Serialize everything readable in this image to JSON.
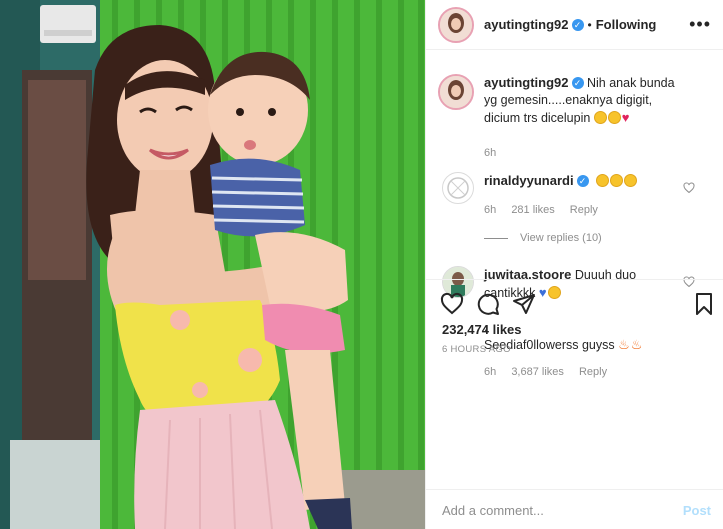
{
  "header": {
    "username": "ayutingting92",
    "separator": "•",
    "follow_status": "Following"
  },
  "caption": {
    "username": "ayutingting92",
    "text": "Nih anak bunda yg gemesin.....enaknya digigit, dicium trs dicelupin",
    "emojis": [
      "smiling-face-icon",
      "kissing-face-icon",
      "red-heart-icon"
    ],
    "time": "6h"
  },
  "comments": [
    {
      "username": "rinaldyyunardi",
      "verified": true,
      "text": "",
      "emojis": [
        "smiling-face-icon",
        "smiling-face-icon",
        "smiling-face-icon"
      ],
      "time": "6h",
      "likes": "281 likes",
      "reply": "Reply",
      "view_replies": "View replies (10)"
    },
    {
      "username": "juwitaa.stoore",
      "verified": false,
      "text": "Duuuh duo cantikkkk",
      "lines": [
        ".",
        ".",
        "Seediaf0llowerss guyss"
      ],
      "emojis": [
        "blue-heart-icon",
        "heart-eyes-face-icon"
      ],
      "trailing_emojis": [
        "fire-icon",
        "fire-icon"
      ],
      "time": "6h",
      "likes": "3,687 likes",
      "reply": "Reply"
    }
  ],
  "post": {
    "likes": "232,474 likes",
    "time_ago": "6 HOURS AGO"
  },
  "add_comment": {
    "placeholder": "Add a comment...",
    "post_label": "Post"
  },
  "colors": {
    "link_blue": "#3897f0",
    "post_disabled": "#b2dffc",
    "wall_green": "#4cb83a",
    "dress_yellow": "#f0e24a",
    "skirt_pink": "#f2c6cc"
  }
}
